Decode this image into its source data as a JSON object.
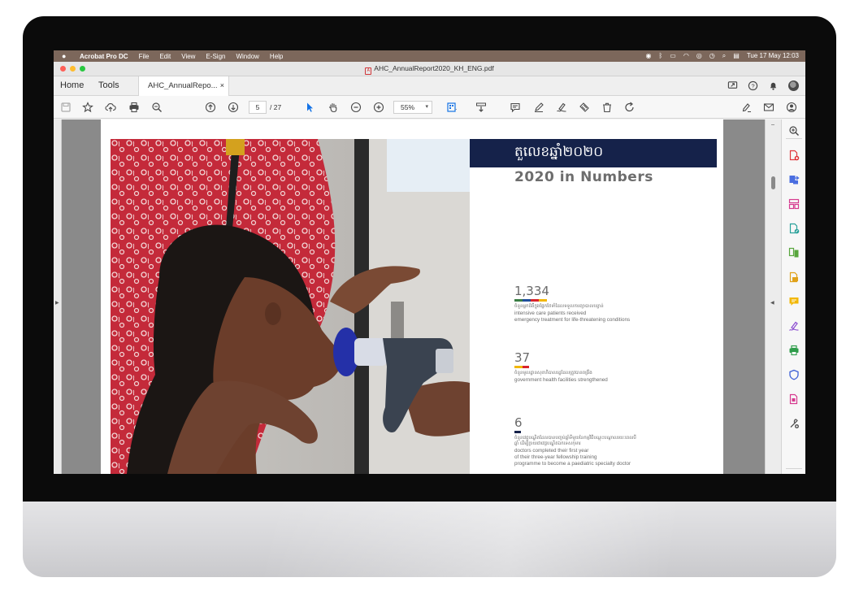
{
  "menubar": {
    "app_name": "Acrobat Pro DC",
    "menus": [
      "File",
      "Edit",
      "View",
      "E-Sign",
      "Window",
      "Help"
    ],
    "datetime": "Tue 17 May  12:03",
    "status_icons": [
      "screen-record-icon",
      "bluetooth-icon",
      "battery-icon",
      "wifi-icon",
      "user-icon",
      "time-machine-icon",
      "spotlight-icon",
      "control-center-icon"
    ]
  },
  "window": {
    "title": "AHC_AnnualReport2020_KH_ENG.pdf"
  },
  "tabs": {
    "home": "Home",
    "tools": "Tools",
    "document": "AHC_AnnualRepo...",
    "close": "×"
  },
  "toolbar": {
    "current_page": "5",
    "total_pages": "/  27",
    "zoom": "55%"
  },
  "page": {
    "khmer_title": "តួលេខឆ្នាំ២០២០",
    "title": "2020 in Numbers",
    "stats": [
      {
        "number": "1,334",
        "khmer": "ចំនួនអ្នកជំងឺក្នុងផ្នែកថែទាំដែលទទួលការព្យាបាលបន្ទាន់",
        "english": [
          "intensive care patients received",
          "emergency treatment for life-threatening conditions"
        ],
        "bar_colors": [
          "#3a7d44",
          "#1f4e9c",
          "#d9242c",
          "#f2b705"
        ]
      },
      {
        "number": "37",
        "khmer": "ចំនួនមូលដ្ឋានសុខាភិបាលរដ្ឋដែលត្រូវបានពង្រឹង",
        "english": [
          "government health facilities strengthened"
        ],
        "bar_colors": [
          "#f2b705",
          "#d9242c"
        ]
      },
      {
        "number": "6",
        "khmer": "ចំនួនវេជ្ជបណ្ឌិតដែលបានបញ្ចប់ឆ្នាំទីមួយនៃកម្មវិធីបណ្តុះបណ្តាលរយៈពេលបីឆ្នាំ ដើម្បីក្លាយជាវេជ្ជបណ្ឌិតឯកទេសកុមារ",
        "english": [
          "doctors completed their first year",
          "of their three-year fellowship training",
          "programme to become a paediatric specialty doctor"
        ],
        "bar_colors": [
          "#15224a"
        ]
      }
    ]
  },
  "colors": {
    "title_bar": "#15224a",
    "menubar": "#7c675b",
    "accent": "#1473e6"
  }
}
